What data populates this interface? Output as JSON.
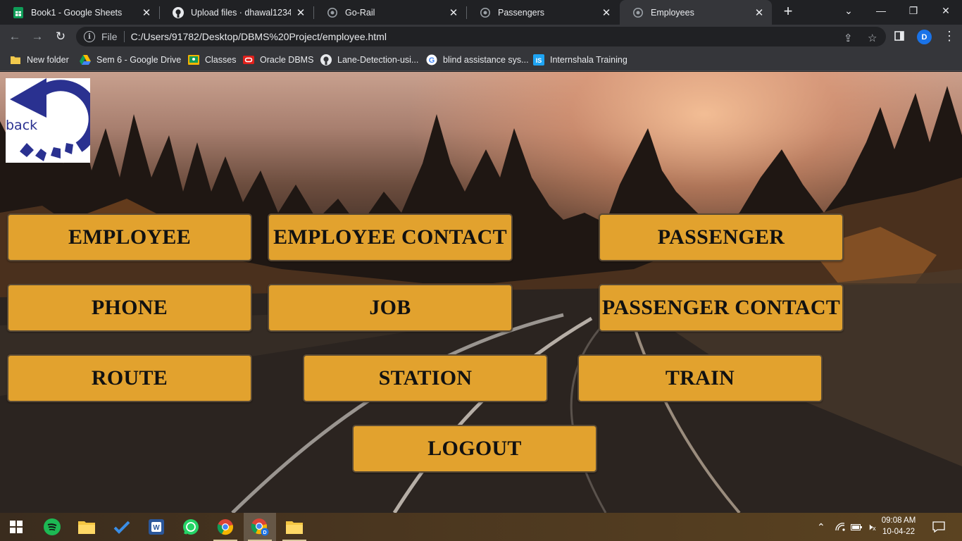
{
  "browser": {
    "tabs": [
      {
        "title": "Book1 - Google Sheets",
        "icon": "sheets-icon"
      },
      {
        "title": "Upload files · dhawal123456/",
        "icon": "github-icon"
      },
      {
        "title": "Go-Rail",
        "icon": "globe-icon"
      },
      {
        "title": "Passengers",
        "icon": "globe-icon"
      },
      {
        "title": "Employees",
        "icon": "globe-icon",
        "active": true
      }
    ],
    "address": {
      "scheme": "File",
      "url": "C:/Users/91782/Desktop/DBMS%20Project/employee.html"
    },
    "profile_initial": "D",
    "bookmarks": [
      {
        "label": "New folder",
        "icon": "folder-icon"
      },
      {
        "label": "Sem 6 - Google Drive",
        "icon": "drive-icon"
      },
      {
        "label": "Classes",
        "icon": "classroom-icon"
      },
      {
        "label": "Oracle DBMS",
        "icon": "oracle-icon"
      },
      {
        "label": "Lane-Detection-usi...",
        "icon": "github-icon"
      },
      {
        "label": "blind assistance sys...",
        "icon": "google-icon"
      },
      {
        "label": "Internshala Training",
        "icon": "internshala-icon"
      }
    ]
  },
  "page": {
    "back_label": "back",
    "buttons": {
      "employee": "EMPLOYEE",
      "employee_contact": "EMPLOYEE CONTACT",
      "passenger": "PASSENGER",
      "phone": "PHONE",
      "job": "JOB",
      "passenger_contact": "PASSENGER CONTACT",
      "route": "ROUTE",
      "station": "STATION",
      "train": "TRAIN",
      "logout": "LOGOUT"
    },
    "button_color": "#e2a22e"
  },
  "taskbar": {
    "apps": [
      "windows-start-icon",
      "spotify-icon",
      "file-explorer-icon",
      "todo-icon",
      "word-icon",
      "whatsapp-icon",
      "chrome-icon",
      "chrome-profile-icon",
      "file-explorer-icon"
    ],
    "clock": {
      "time": "09:08 AM",
      "date": "10-04-22"
    }
  }
}
